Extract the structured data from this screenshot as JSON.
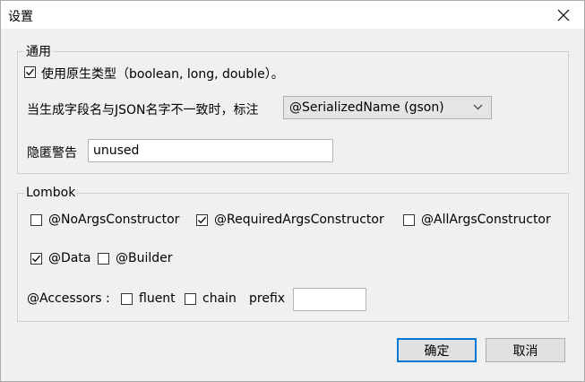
{
  "window": {
    "title": "设置"
  },
  "general": {
    "legend": "通用",
    "use_primitive": {
      "label": "使用原生类型（boolean, long, double）。",
      "checked": true
    },
    "annotation_label": "当生成字段名与JSON名字不一致时，标注",
    "annotation_select": "@SerializedName (gson)",
    "suppress_label": "隐匿警告",
    "suppress_value": "unused"
  },
  "lombok": {
    "legend": "Lombok",
    "no_args": {
      "label": "@NoArgsConstructor",
      "checked": false
    },
    "required_args": {
      "label": "@RequiredArgsConstructor",
      "checked": true
    },
    "all_args": {
      "label": "@AllArgsConstructor",
      "checked": false
    },
    "data": {
      "label": "@Data",
      "checked": true
    },
    "builder": {
      "label": "@Builder",
      "checked": false
    },
    "accessors_label": "@Accessors :",
    "fluent": {
      "label": "fluent",
      "checked": false
    },
    "chain": {
      "label": "chain",
      "checked": false
    },
    "prefix_label": "prefix",
    "prefix_value": ""
  },
  "buttons": {
    "ok": "确定",
    "cancel": "取消"
  },
  "colors": {
    "accent": "#0078d7",
    "background": "#f0f0f0",
    "titlebar": "#ffffff"
  }
}
